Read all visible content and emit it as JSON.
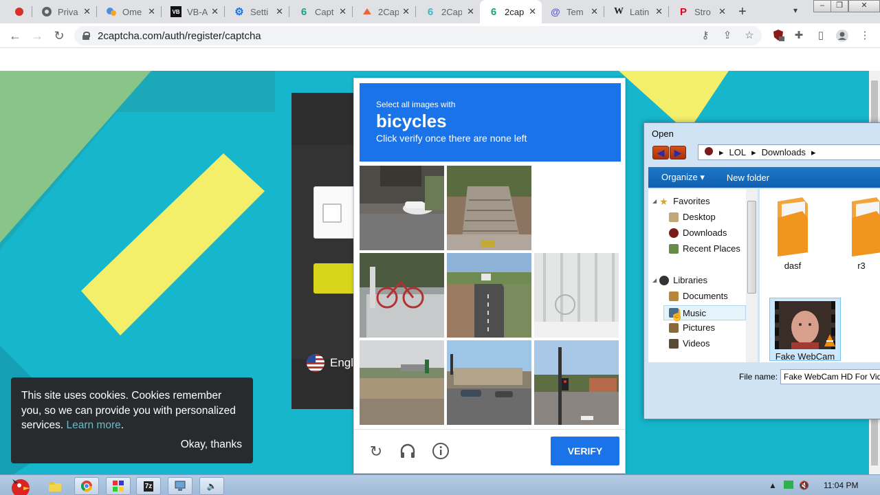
{
  "browser": {
    "tabs": [
      {
        "label": "Priva",
        "icon": "globe-icon"
      },
      {
        "label": "Ome",
        "icon": "omegle-icon"
      },
      {
        "label": "VB-A",
        "icon": "vb-audio-icon"
      },
      {
        "label": "Setti",
        "icon": "gear-icon"
      },
      {
        "label": "Capt",
        "icon": "2captcha-icon"
      },
      {
        "label": "2Cap",
        "icon": "2captcha-icon"
      },
      {
        "label": "2Cap",
        "icon": "2captcha-icon"
      },
      {
        "label": "2cap",
        "icon": "2captcha-icon",
        "active": true
      },
      {
        "label": "Tem",
        "icon": "at-icon"
      },
      {
        "label": "Latin",
        "icon": "wikipedia-icon"
      },
      {
        "label": "Stro",
        "icon": "pinterest-icon"
      }
    ],
    "url": "2captcha.com/auth/register/captcha"
  },
  "page": {
    "language_label": "Engli",
    "cookie": {
      "text": "This site uses cookies. Cookies remember you, so we can provide you with personalized services.",
      "learn_more": "Learn more",
      "ok_label": "Okay, thanks"
    }
  },
  "captcha": {
    "instruction_small": "Select all images with",
    "target": "bicycles",
    "instruction_sub": "Click verify once there are none left",
    "verify_label": "VERIFY"
  },
  "dialog": {
    "title": "Open",
    "path": [
      "LOL",
      "Downloads"
    ],
    "organize_label": "Organize",
    "new_folder_label": "New folder",
    "favorites_label": "Favorites",
    "favorites": [
      "Desktop",
      "Downloads",
      "Recent Places"
    ],
    "libraries_label": "Libraries",
    "libraries": [
      "Documents",
      "Music",
      "Pictures",
      "Videos"
    ],
    "files": [
      "dasf",
      "r3",
      "Fake WebCam"
    ],
    "filename_label": "File name:",
    "filename_value": "Fake WebCam HD For Video"
  },
  "taskbar": {
    "clock": "11:04 PM",
    "apps": [
      "explorer-icon",
      "chrome-icon",
      "rainmeter-icon",
      "7zip-icon",
      "network-icon",
      "volume-icon"
    ]
  },
  "colors": {
    "accent": "#1a73e8",
    "bg_teal": "#16b6cc",
    "bg_yellow": "#f3ef6a"
  }
}
